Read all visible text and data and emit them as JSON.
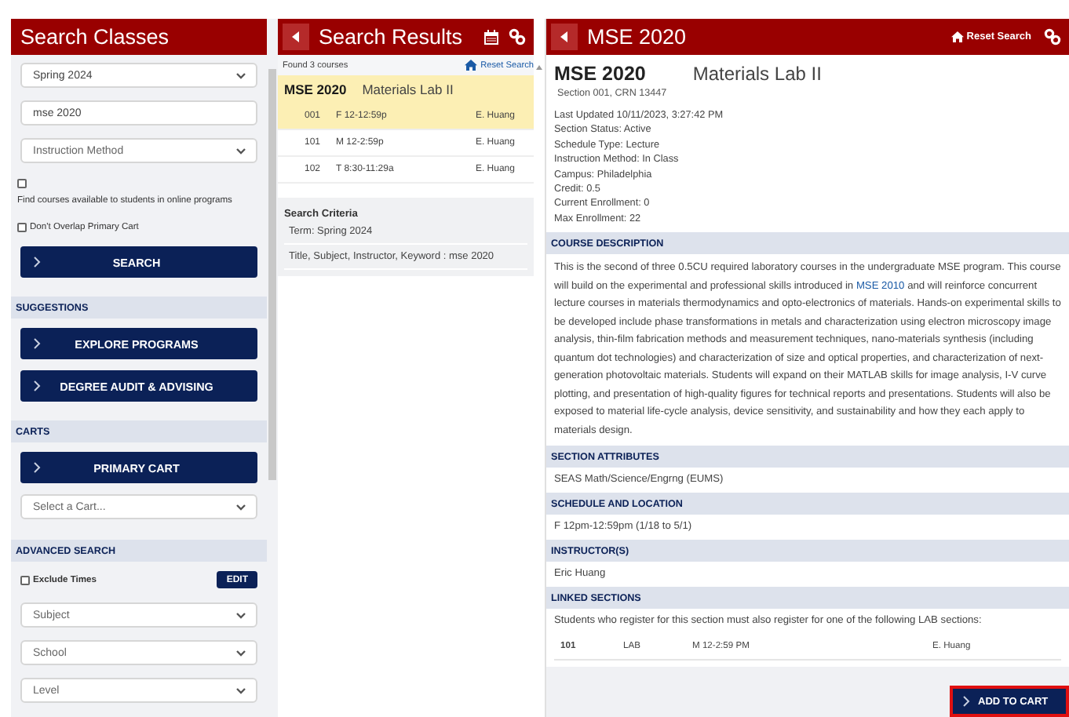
{
  "search_panel": {
    "title": "Search Classes",
    "term_select": {
      "value": "Spring 2024"
    },
    "keyword_field": {
      "value": "mse 2020"
    },
    "method_select": {
      "placeholder": "Instruction Method"
    },
    "online_checkbox": {
      "label": "Find courses available to students in online programs",
      "checked": false
    },
    "overlap_checkbox": {
      "label": "Don't Overlap Primary Cart",
      "checked": false
    },
    "search_button": "SEARCH",
    "suggestions": {
      "heading": "SUGGESTIONS",
      "buttons": [
        "EXPLORE PROGRAMS",
        "DEGREE AUDIT & ADVISING"
      ]
    },
    "carts": {
      "heading": "CARTS",
      "button": "PRIMARY CART",
      "select": {
        "placeholder": "Select a Cart..."
      }
    },
    "advanced": {
      "heading": "ADVANCED SEARCH",
      "exclude_times": {
        "label": "Exclude Times",
        "checked": false
      },
      "edit_button": "EDIT",
      "selects": [
        {
          "placeholder": "Subject"
        },
        {
          "placeholder": "School"
        },
        {
          "placeholder": "Level"
        }
      ]
    }
  },
  "results_panel": {
    "title": "Search Results",
    "found": "Found 3 courses",
    "reset_link": "Reset Search",
    "course": {
      "code": "MSE 2020",
      "title": "Materials Lab II",
      "sections": [
        {
          "number": "001",
          "time": "F 12-12:59p",
          "instructor": "E. Huang",
          "selected": true
        },
        {
          "number": "101",
          "time": "M 12-2:59p",
          "instructor": "E. Huang",
          "selected": false
        },
        {
          "number": "102",
          "time": "T 8:30-11:29a",
          "instructor": "E. Huang",
          "selected": false
        }
      ]
    },
    "criteria": {
      "heading": "Search Criteria",
      "items": [
        "Term: Spring 2024",
        "Title, Subject, Instructor, Keyword : mse 2020"
      ]
    }
  },
  "detail_panel": {
    "title": "MSE 2020",
    "reset_link": "Reset Search",
    "course_code": "MSE 2020",
    "course_title": "Materials Lab II",
    "section_line": "Section 001, CRN 13447",
    "details": [
      "Last Updated 10/11/2023, 3:27:42 PM",
      "Section Status: Active",
      "Schedule Type: Lecture",
      "Instruction Method: In Class",
      "Campus: Philadelphia",
      "Credit: 0.5",
      "Current Enrollment: 0",
      "Max Enrollment: 22"
    ],
    "sections": [
      {
        "kind": "description",
        "heading": "COURSE DESCRIPTION",
        "text_before": "This is the second of three 0.5CU required laboratory courses in the undergraduate MSE program. This course will build on the experimental and professional skills introduced in",
        "link": "MSE 2010",
        "text_after": "and will reinforce concurrent lecture courses in materials thermodynamics and opto-electronics of materials. Hands-on experimental skills to be developed include phase transformations in metals and characterization using electron microscopy image analysis, thin-film fabrication methods and measurement techniques, nano-materials synthesis (including quantum dot technologies) and characterization of size and optical properties, and characterization of next-generation photovoltaic materials. Students will expand on their MATLAB skills for image analysis, I-V curve plotting, and presentation of high-quality figures for technical reports and presentations. Students will also be exposed to material life-cycle analysis, device sensitivity, and sustainability and how they each apply to materials design."
      },
      {
        "kind": "text",
        "heading": "SECTION ATTRIBUTES",
        "text": "SEAS Math/Science/Engrng (EUMS)"
      },
      {
        "kind": "text",
        "heading": "SCHEDULE AND LOCATION",
        "text": "F 12pm-12:59pm (1/18 to 5/1)"
      },
      {
        "kind": "text",
        "heading": "INSTRUCTOR(S)",
        "text": "Eric Huang"
      },
      {
        "kind": "linked",
        "heading": "LINKED SECTIONS",
        "text": "Students who register for this section must also register for one of the following LAB sections:",
        "rows": [
          {
            "number": "101",
            "type": "LAB",
            "time": "M 12-2:59 PM",
            "instructor": "E. Huang"
          }
        ]
      }
    ],
    "add_button": "ADD TO CART"
  }
}
